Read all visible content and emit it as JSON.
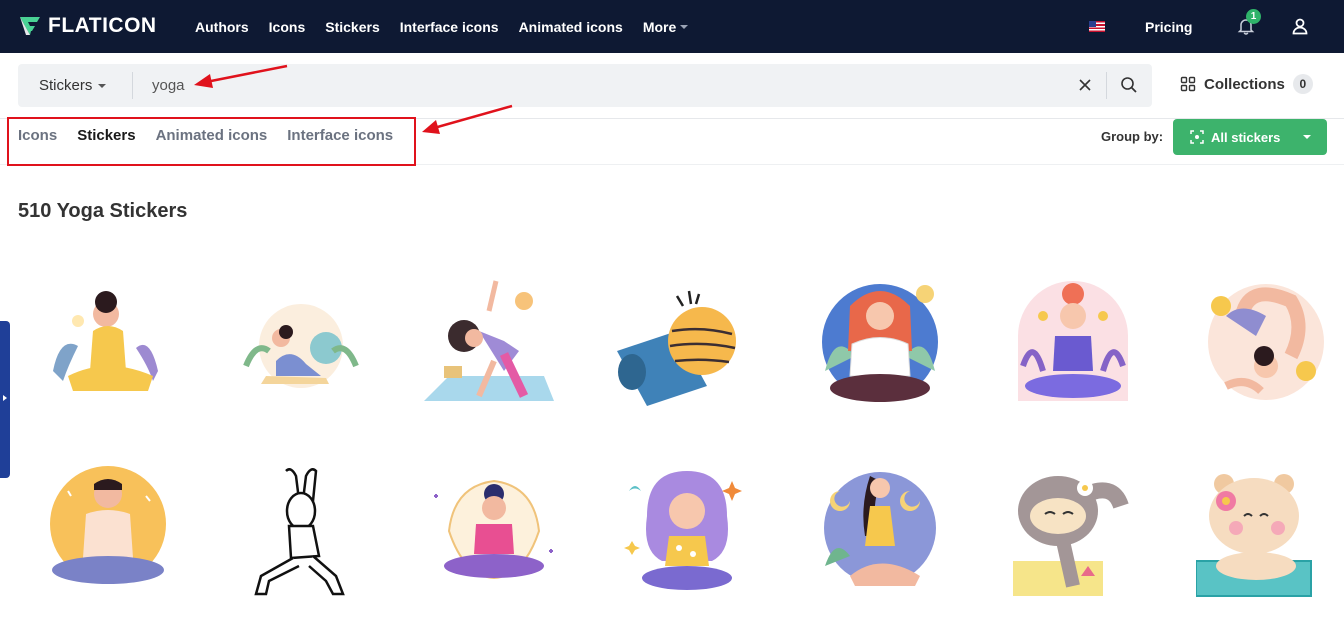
{
  "nav": {
    "logo_text": "FLATICON",
    "links": [
      "Authors",
      "Icons",
      "Stickers",
      "Interface icons",
      "Animated icons"
    ],
    "more_label": "More",
    "pricing_label": "Pricing",
    "notification_count": "1"
  },
  "search": {
    "type_label": "Stickers",
    "query": "yoga"
  },
  "collections": {
    "label": "Collections",
    "count": "0"
  },
  "tabs": {
    "items": [
      "Icons",
      "Stickers",
      "Animated icons",
      "Interface icons"
    ],
    "active": "Stickers"
  },
  "group_by": {
    "label": "Group by:",
    "button_label": "All stickers"
  },
  "results": {
    "title": "510 Yoga Stickers"
  },
  "colors": {
    "nav_bg": "#0e1933",
    "accent_green": "#3db36c",
    "annotation_red": "#e0121c",
    "side_tab": "#1f3f98"
  },
  "stickers": [
    {
      "name": "sticker-yoga-woman-stretch"
    },
    {
      "name": "sticker-yoga-cobra-pose"
    },
    {
      "name": "sticker-yoga-triangle-pose"
    },
    {
      "name": "sticker-yoga-mat-and-ball"
    },
    {
      "name": "sticker-yoga-meditation-woman"
    },
    {
      "name": "sticker-yoga-lotus-arch"
    },
    {
      "name": "sticker-yoga-backbend"
    },
    {
      "name": "sticker-yoga-meditation-man"
    },
    {
      "name": "sticker-yoga-outline-warrior"
    },
    {
      "name": "sticker-yoga-lotus-mandala"
    },
    {
      "name": "sticker-yoga-purple-hair"
    },
    {
      "name": "sticker-yoga-night-stretch"
    },
    {
      "name": "sticker-yoga-sloth"
    },
    {
      "name": "sticker-yoga-bear"
    }
  ]
}
